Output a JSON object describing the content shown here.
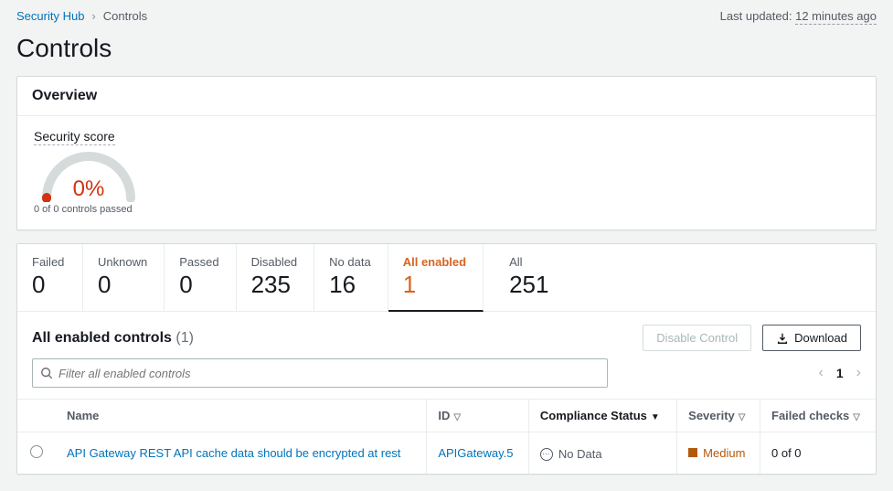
{
  "breadcrumb": {
    "root": "Security Hub",
    "current": "Controls"
  },
  "last_updated": {
    "label": "Last updated:",
    "value": "12 minutes ago"
  },
  "page_title": "Controls",
  "overview": {
    "heading": "Overview",
    "score_label": "Security score",
    "score_pct": "0%",
    "score_sub": "0 of 0 controls passed"
  },
  "tabs": {
    "failed": {
      "label": "Failed",
      "value": "0"
    },
    "unknown": {
      "label": "Unknown",
      "value": "0"
    },
    "passed": {
      "label": "Passed",
      "value": "0"
    },
    "disabled": {
      "label": "Disabled",
      "value": "235"
    },
    "nodata": {
      "label": "No data",
      "value": "16"
    },
    "enabled": {
      "label": "All enabled",
      "value": "1"
    },
    "all": {
      "label": "All",
      "value": "251"
    }
  },
  "list": {
    "title": "All enabled controls",
    "count": "(1)",
    "disable_btn": "Disable Control",
    "download_btn": "Download",
    "filter_placeholder": "Filter all enabled controls",
    "page": "1"
  },
  "columns": {
    "name": "Name",
    "id": "ID",
    "compliance": "Compliance Status",
    "severity": "Severity",
    "failed": "Failed checks"
  },
  "rows": [
    {
      "name": "API Gateway REST API cache data should be encrypted at rest",
      "id": "APIGateway.5",
      "compliance": "No Data",
      "severity": "Medium",
      "failed": "0 of 0"
    }
  ]
}
